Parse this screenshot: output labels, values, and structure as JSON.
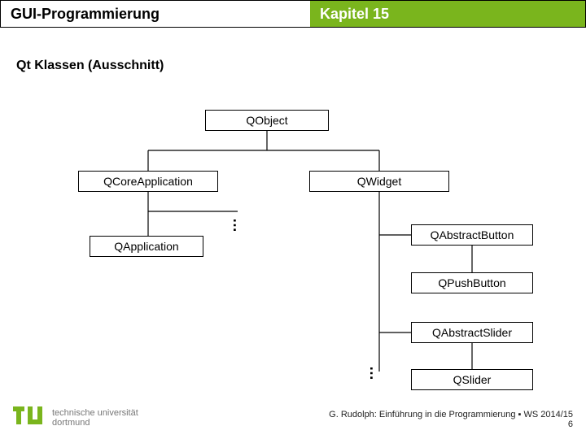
{
  "header": {
    "left": "GUI-Programmierung",
    "right": "Kapitel 15"
  },
  "subtitle": "Qt Klassen (Ausschnitt)",
  "nodes": {
    "qobject": "QObject",
    "qcoreapplication": "QCoreApplication",
    "qwidget": "QWidget",
    "qapplication": "QApplication",
    "qabstractbutton": "QAbstractButton",
    "qpushbutton": "QPushButton",
    "qabstractslider": "QAbstractSlider",
    "qslider": "QSlider"
  },
  "ellipsis": "…",
  "footer": {
    "uni_line1": "technische universität",
    "uni_line2": "dortmund",
    "credit": "G. Rudolph: Einführung in die Programmierung ▪ WS 2014/15",
    "page": "6"
  },
  "chart_data": {
    "type": "tree",
    "title": "Qt Klassen (Ausschnitt)",
    "root": "QObject",
    "edges": [
      [
        "QObject",
        "QCoreApplication"
      ],
      [
        "QObject",
        "QWidget"
      ],
      [
        "QCoreApplication",
        "QApplication"
      ],
      [
        "QCoreApplication",
        "…"
      ],
      [
        "QWidget",
        "QAbstractButton"
      ],
      [
        "QWidget",
        "QAbstractSlider"
      ],
      [
        "QWidget",
        "…"
      ],
      [
        "QAbstractButton",
        "QPushButton"
      ],
      [
        "QAbstractSlider",
        "QSlider"
      ]
    ]
  }
}
